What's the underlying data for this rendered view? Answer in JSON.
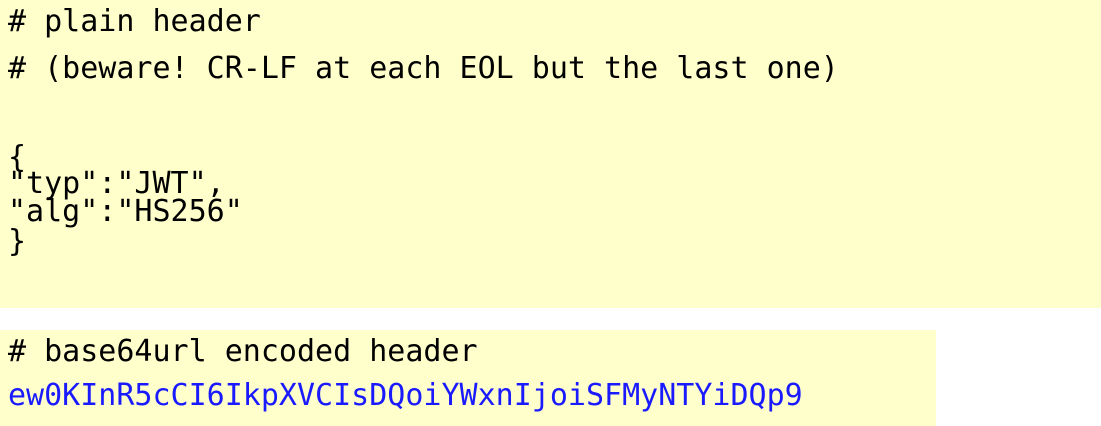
{
  "plain_header": {
    "comment_1": "# plain header",
    "comment_2": "# (beware! CR-LF at each EOL but the last one)",
    "json_lines": [
      "{",
      "\"typ\":\"JWT\",",
      "\"alg\":\"HS256\"",
      "}"
    ]
  },
  "encoded_header": {
    "comment": "# base64url encoded header",
    "value": "ew0KInR5cCI6IkpXVCIsDQoiYWxnIjoiSFMyNTYiDQp9"
  },
  "colors": {
    "block_background": "#ffffcc",
    "encoded_text": "#1a1aff",
    "text": "#000000"
  }
}
